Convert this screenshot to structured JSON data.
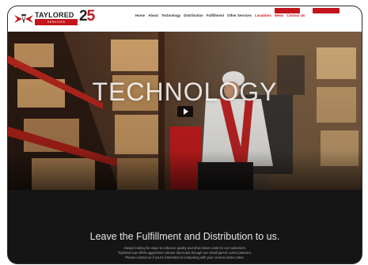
{
  "header": {
    "logo": {
      "name": "TAYLORED",
      "sub": "SERVICES",
      "anniv_digit1": "2",
      "anniv_digit2": "5"
    },
    "nav": [
      {
        "label": "Home"
      },
      {
        "label": "About"
      },
      {
        "label": "Technology"
      },
      {
        "label": "Distribution"
      },
      {
        "label": "Fulfillment"
      },
      {
        "label": "Other Services"
      },
      {
        "label": "Locations"
      },
      {
        "label": "News"
      },
      {
        "label": "Contact Us"
      }
    ]
  },
  "hero": {
    "title": "TECHNOLOGY"
  },
  "cta": {
    "heading": "Leave the Fulfillment and Distribution to us.",
    "line1": "Always looking for ways to enhance quality and drive down costs for our customers.",
    "line2": "Taylored now offers aggressive volume discounts through our Small parcel carrier partners.",
    "line3": "Please contact us if you're interested in comparing with your current carrier rates."
  },
  "colors": {
    "brand_red": "#c3161c",
    "page_bg": "#151515"
  },
  "icons": [
    "logo-wings-icon",
    "play-icon"
  ]
}
